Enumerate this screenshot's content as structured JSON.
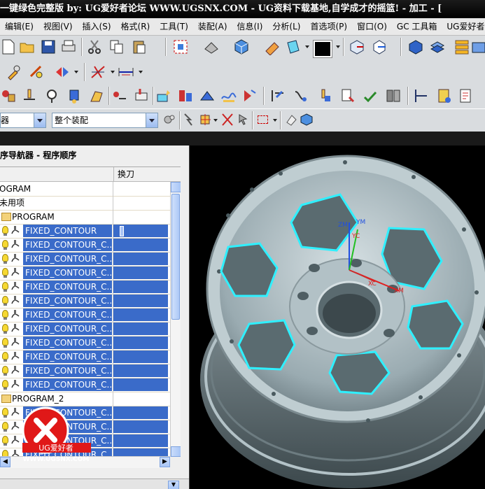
{
  "window": {
    "title": "一键绿色完整版   by: UG爱好者论坛  WWW.UGSNX.COM - UG资料下载基地,自学成才的摇篮!  - 加工 - ["
  },
  "menu": [
    "编辑(E)",
    "视图(V)",
    "插入(S)",
    "格式(R)",
    "工具(T)",
    "装配(A)",
    "信息(I)",
    "分析(L)",
    "首选项(P)",
    "窗口(O)",
    "GC 工具箱",
    "UG爱好者论坛帮助"
  ],
  "selection_bar": {
    "filter_value": "器",
    "scope_value": "整个装配"
  },
  "navigator": {
    "title": "序导航器 - 程序顺序",
    "columns": [
      "",
      "换刀"
    ],
    "rows": [
      {
        "label": "OGRAM",
        "type": "root",
        "selected": false,
        "indent": 0
      },
      {
        "label": "未用项",
        "type": "folder",
        "selected": false,
        "indent": 0
      },
      {
        "label": "PROGRAM",
        "type": "program",
        "selected": false,
        "indent": 1
      },
      {
        "label": "FIXED_CONTOUR",
        "type": "op",
        "selected": true,
        "toolchange": true
      },
      {
        "label": "FIXED_CONTOUR_C...",
        "type": "op",
        "selected": true
      },
      {
        "label": "FIXED_CONTOUR_C...",
        "type": "op",
        "selected": true
      },
      {
        "label": "FIXED_CONTOUR_C...",
        "type": "op",
        "selected": true
      },
      {
        "label": "FIXED_CONTOUR_C...",
        "type": "op",
        "selected": true
      },
      {
        "label": "FIXED_CONTOUR_C...",
        "type": "op",
        "selected": true
      },
      {
        "label": "FIXED_CONTOUR_C...",
        "type": "op",
        "selected": true
      },
      {
        "label": "FIXED_CONTOUR_C...",
        "type": "op",
        "selected": true
      },
      {
        "label": "FIXED_CONTOUR_C...",
        "type": "op",
        "selected": true
      },
      {
        "label": "FIXED_CONTOUR_C...",
        "type": "op",
        "selected": true
      },
      {
        "label": "FIXED_CONTOUR_C...",
        "type": "op",
        "selected": true
      },
      {
        "label": "FIXED_CONTOUR_C...",
        "type": "op",
        "selected": true
      },
      {
        "label": "PROGRAM_2",
        "type": "program",
        "selected": false,
        "indent": 1
      },
      {
        "label": "FIXED_CONTOUR_C...",
        "type": "op",
        "selected": true
      },
      {
        "label": "FIXED_CONTOUR_C...",
        "type": "op",
        "selected": true
      },
      {
        "label": "FIXED_CONTOUR_C...",
        "type": "op",
        "selected": true
      },
      {
        "label": "FIXED_CONTOUR_C...",
        "type": "op",
        "selected": true
      }
    ]
  },
  "viewport": {
    "triad": {
      "x": "XC",
      "y": "YC",
      "zm": "ZM",
      "ym": "YM",
      "xm": "XM"
    }
  },
  "watermark": {
    "site": "WWW.UGSNX.COM",
    "brand": "UG爱好者"
  },
  "colors": {
    "selection": "#3a6bc9",
    "toolpath": "#2ff0ff",
    "part": "#a9b9bd"
  }
}
